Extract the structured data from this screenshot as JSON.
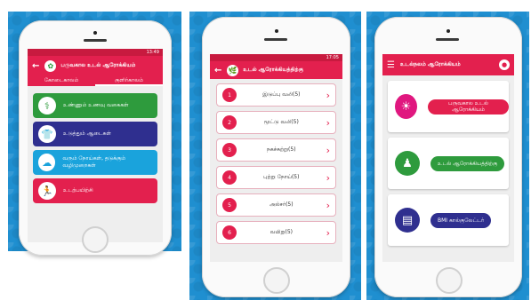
{
  "colors": {
    "brand_red": "#e3204e",
    "green": "#2e9b3d",
    "navy": "#2f2f8f",
    "sky": "#1aa3dc",
    "magenta": "#e0177f",
    "blue_bg": "#1f8fd0"
  },
  "phone1": {
    "status_time": "13:49",
    "title": "பருவகால உடல் ஆரோக்கியம்",
    "tabs": [
      "கோடைகாலம்",
      "குளிர்காலம்"
    ],
    "buttons": [
      {
        "label": "உண்ணும் உணவு வகைகள்",
        "icon": "food-icon",
        "color": "#2e9b3d"
      },
      {
        "label": "உடுத்தும் ஆடைகள்",
        "icon": "clothes-icon",
        "color": "#2f2f8f"
      },
      {
        "label": "வரும் நோய்கள், தடுக்கும் வழிமுறைகள்",
        "icon": "sick-icon",
        "color": "#1aa3dc"
      },
      {
        "label": "உடற்பயிற்சி",
        "icon": "exercise-icon",
        "color": "#e3204e"
      }
    ]
  },
  "phone2": {
    "status_time": "17:05",
    "title": "உடல் ஆரோக்கியத்திற்கு",
    "rows": [
      {
        "num": "1",
        "label": "இடுப்பு வலி(5)"
      },
      {
        "num": "2",
        "label": "மூட்டு வலி(5)"
      },
      {
        "num": "3",
        "label": "நகச்சுற்று(5)"
      },
      {
        "num": "4",
        "label": "புற்று நோய்(5)"
      },
      {
        "num": "5",
        "label": "அல்சர்(5)"
      },
      {
        "num": "6",
        "label": "வயிறு(5)"
      }
    ]
  },
  "phone3": {
    "title": "உடல்நலம் ஆரோக்கியம்",
    "cards": [
      {
        "label": "பருவகால உடல் ஆரோக்கியம்",
        "icon": "weather-icon",
        "icon_color": "#e0177f",
        "pill_color": "#e3204e"
      },
      {
        "label": "உடல் ஆரோக்கியத்திற்கு",
        "icon": "body-icon",
        "icon_color": "#2e9b3d",
        "pill_color": "#2e9b3d"
      },
      {
        "label": "BMI கால்குலேட்டர்",
        "icon": "scale-icon",
        "icon_color": "#2f2f8f",
        "pill_color": "#2f2f8f"
      }
    ]
  }
}
